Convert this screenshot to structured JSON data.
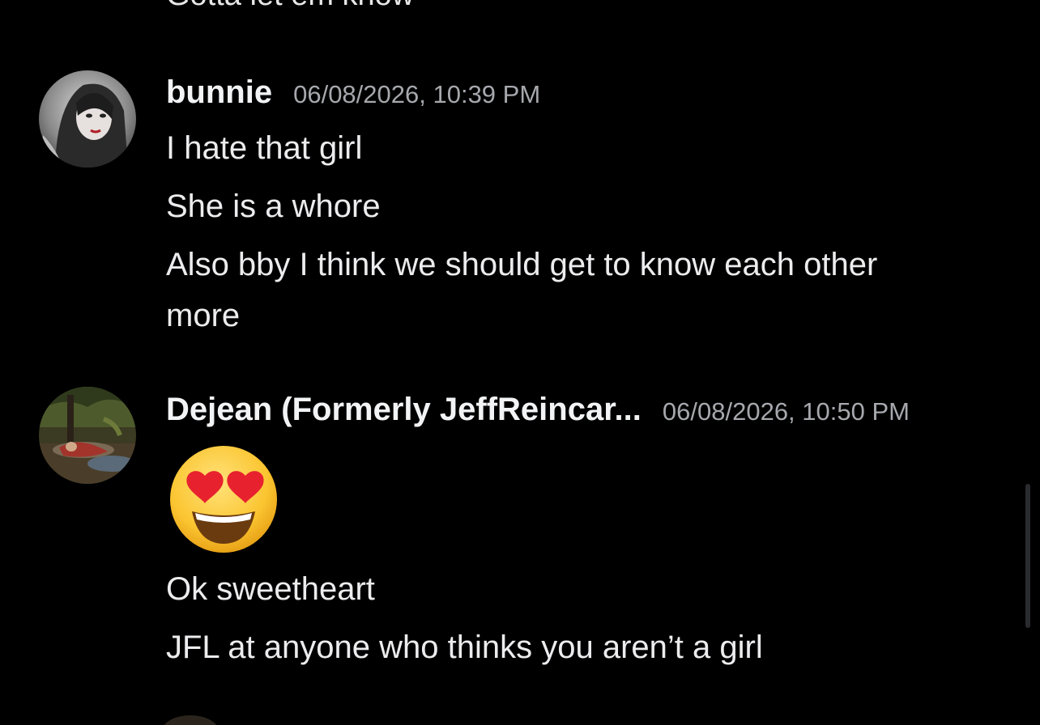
{
  "partial_message": {
    "text": "Gotta let em know"
  },
  "messages": [
    {
      "author": "bunnie",
      "timestamp": "06/08/2026, 10:39 PM",
      "lines": [
        "I hate that girl",
        "She is a whore",
        "Also bby I think we should get to know each other",
        "more"
      ]
    },
    {
      "author": "Dejean (Formerly JeffReincar...",
      "timestamp": "06/08/2026, 10:50 PM",
      "emoji": "heart-eyes-emoji",
      "lines": [
        "Ok sweetheart",
        "JFL at anyone who thinks you aren’t a girl"
      ]
    }
  ],
  "colors": {
    "background": "#000000",
    "username": "#f2f3f5",
    "timestamp": "#a6a8ad",
    "text": "#ececee"
  }
}
